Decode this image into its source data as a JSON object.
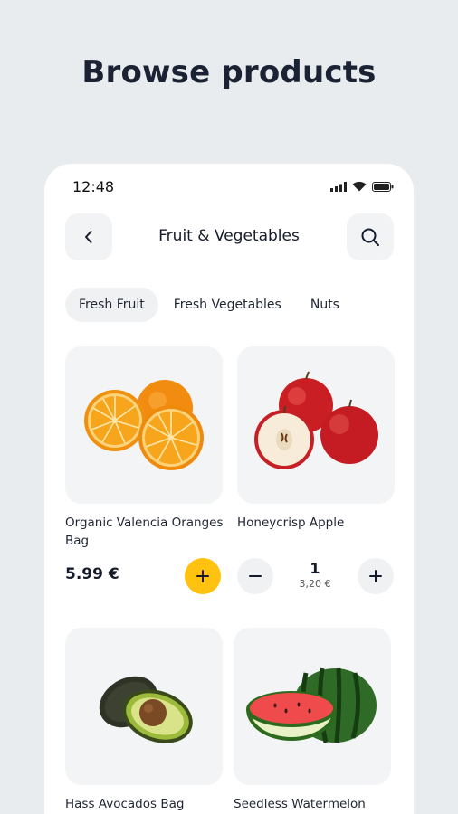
{
  "hero": {
    "title": "Browse products"
  },
  "status_bar": {
    "time": "12:48"
  },
  "header": {
    "title": "Fruit & Vegetables"
  },
  "categories": [
    {
      "label": "Fresh Fruit",
      "active": true
    },
    {
      "label": "Fresh Vegetables",
      "active": false
    },
    {
      "label": "Nuts",
      "active": false
    }
  ],
  "products": [
    {
      "name": "Organic Valencia Oranges Bag",
      "price": "5.99 €"
    },
    {
      "name": "Honeycrisp Apple",
      "quantity": "1",
      "line_total": "3,20 €"
    },
    {
      "name": "Hass Avocados Bag"
    },
    {
      "name": "Seedless Watermelon"
    }
  ],
  "colors": {
    "accent": "#ffc20e",
    "background": "#e9ecef",
    "card": "#f3f4f5"
  },
  "icons": [
    "signal-icon",
    "wifi-icon",
    "battery-icon",
    "back-arrow-icon",
    "search-icon",
    "plus-icon",
    "minus-icon"
  ]
}
